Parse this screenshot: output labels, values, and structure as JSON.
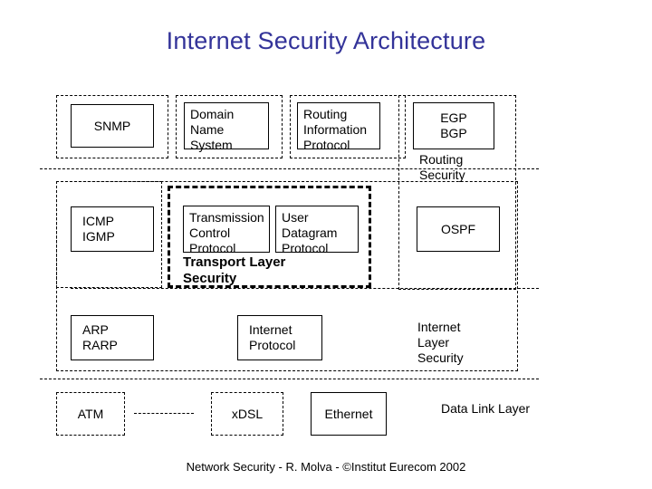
{
  "slide": {
    "title": "Internet Security Architecture",
    "footer": "Network Security - R. Molva - ©Institut Eurecom 2002"
  },
  "layers": {
    "application": {
      "boxes": [
        {
          "label": "SNMP"
        },
        {
          "label": "Domain\nName\nSystem"
        },
        {
          "label": "Routing\nInformation\nProtocol"
        },
        {
          "label": "EGP\nBGP"
        }
      ]
    },
    "transport": {
      "boxes": [
        {
          "label": "ICMP\nIGMP"
        },
        {
          "label": "Transmission\nControl\nProtocol"
        },
        {
          "label": "User\nDatagram\nProtocol"
        },
        {
          "label": "OSPF"
        }
      ],
      "security_label": "Transport Layer\nSecurity"
    },
    "internet": {
      "boxes": [
        {
          "label": "ARP\nRARP"
        },
        {
          "label": "Internet\nProtocol"
        }
      ],
      "security_label": "Internet\nLayer\nSecurity"
    },
    "datalink": {
      "boxes": [
        {
          "label": "ATM"
        },
        {
          "label": "xDSL"
        },
        {
          "label": "Ethernet"
        }
      ],
      "layer_label": "Data Link Layer"
    },
    "routing": {
      "security_label": "Routing\nSecurity"
    }
  }
}
